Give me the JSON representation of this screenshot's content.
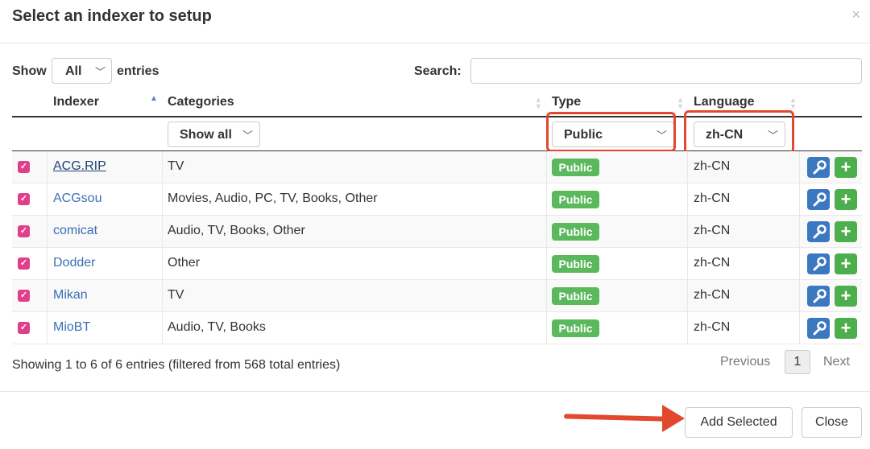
{
  "dialog": {
    "title": "Select an indexer to setup",
    "close_glyph": "×"
  },
  "length": {
    "show_label": "Show",
    "value": "All",
    "entries_label": "entries"
  },
  "search": {
    "label": "Search:",
    "value": "",
    "placeholder": ""
  },
  "columns": [
    "Indexer",
    "Categories",
    "Type",
    "Language"
  ],
  "filters": {
    "categories": "Show all",
    "type": "Public",
    "language": "zh-CN"
  },
  "rows": [
    {
      "indexer": "ACG.RIP",
      "categories": "TV",
      "type": "Public",
      "language": "zh-CN",
      "checked": true
    },
    {
      "indexer": "ACGsou",
      "categories": "Movies, Audio, PC, TV, Books, Other",
      "type": "Public",
      "language": "zh-CN",
      "checked": true
    },
    {
      "indexer": "comicat",
      "categories": "Audio, TV, Books, Other",
      "type": "Public",
      "language": "zh-CN",
      "checked": true
    },
    {
      "indexer": "Dodder",
      "categories": "Other",
      "type": "Public",
      "language": "zh-CN",
      "checked": true
    },
    {
      "indexer": "Mikan",
      "categories": "TV",
      "type": "Public",
      "language": "zh-CN",
      "checked": true
    },
    {
      "indexer": "MioBT",
      "categories": "Audio, TV, Books",
      "type": "Public",
      "language": "zh-CN",
      "checked": true
    }
  ],
  "info": "Showing 1 to 6 of 6 entries (filtered from 568 total entries)",
  "pagination": {
    "previous": "Previous",
    "current": "1",
    "next": "Next"
  },
  "footer": {
    "add_selected": "Add Selected",
    "close": "Close"
  },
  "colors": {
    "checkbox": "#e0408a",
    "public_badge": "#5cb85c",
    "wrench_button": "#3b78c0",
    "add_button": "#4cae4c",
    "annotation": "#e2482e"
  },
  "icons": {
    "close": "close-icon",
    "sort": "sort-icon",
    "wrench": "wrench-icon",
    "plus": "plus-icon",
    "chevron": "chevron-down-icon"
  }
}
